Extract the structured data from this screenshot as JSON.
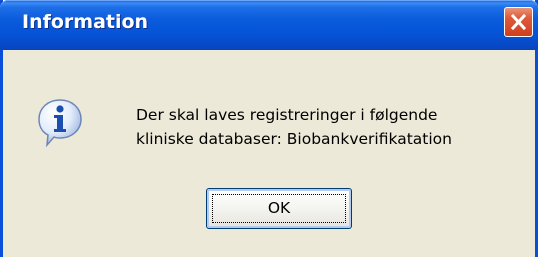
{
  "dialog": {
    "title": "Information",
    "close_icon": "close-icon",
    "icon": "information-icon",
    "message_lines": [
      "Der skal laves registreringer i følgende",
      "kliniske databaser: Biobankverifikatation"
    ],
    "ok_label": "OK"
  },
  "colors": {
    "titlebar": "#0a5bdc",
    "close_button": "#de5a3a",
    "dialog_body": "#ece9d8"
  }
}
